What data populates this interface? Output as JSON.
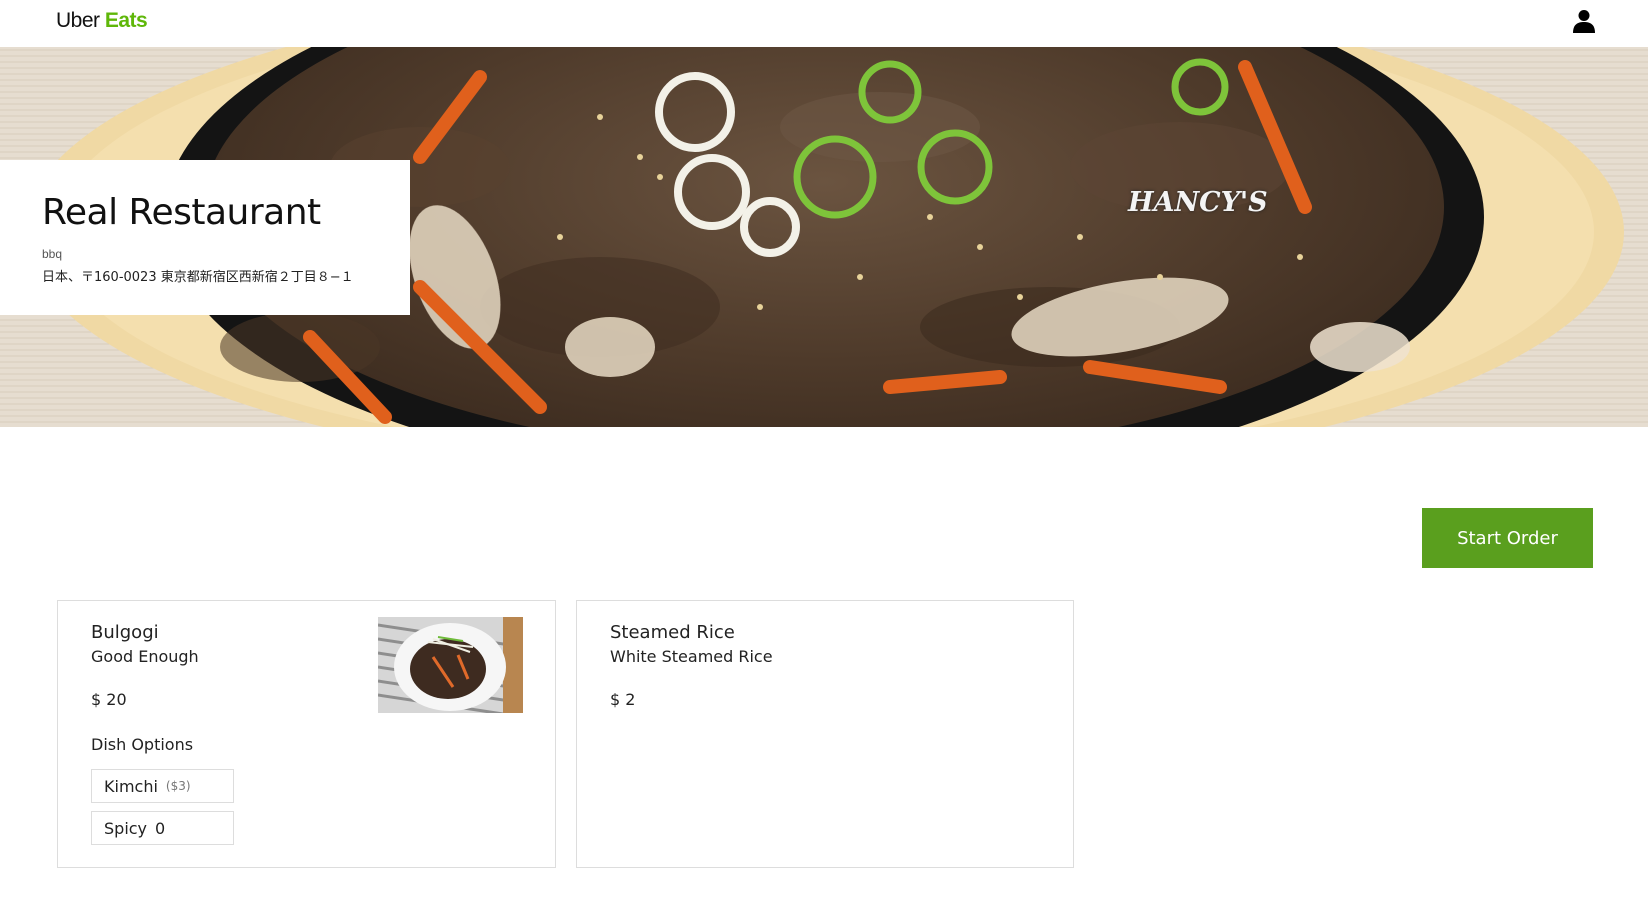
{
  "header": {
    "logo_uber": "Uber",
    "logo_eats": "Eats",
    "user_icon": "user-icon"
  },
  "hero": {
    "watermark": "HANCY'S",
    "restaurant_name": "Real Restaurant",
    "category": "bbq",
    "address": "日本、〒160-0023 東京都新宿区西新宿２丁目８−１"
  },
  "actions": {
    "start_order": "Start Order"
  },
  "dishes": [
    {
      "name": "Bulgogi",
      "description": "Good Enough",
      "price": "$ 20",
      "options_title": "Dish Options",
      "options": [
        {
          "name": "Kimchi",
          "extra": "($3)"
        },
        {
          "name": "Spicy",
          "extra": "0"
        }
      ]
    },
    {
      "name": "Steamed Rice",
      "description": "White Steamed Rice",
      "price": "$ 2"
    }
  ],
  "colors": {
    "brand_green": "#5fb709",
    "button_green": "#5a9f1e"
  }
}
